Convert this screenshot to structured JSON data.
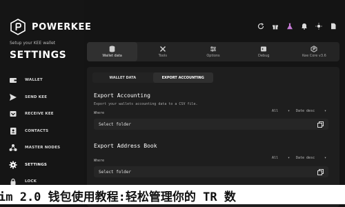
{
  "brand": {
    "name": "POWERKEE"
  },
  "sidebar": {
    "subtitle": "Setup your KEE wallet",
    "title": "SETTINGS",
    "items": [
      {
        "label": "WALLET",
        "icon": "wallet-icon"
      },
      {
        "label": "SEND KEE",
        "icon": "send-icon"
      },
      {
        "label": "RECEIVE KEE",
        "icon": "receive-icon"
      },
      {
        "label": "CONTACTS",
        "icon": "contacts-icon"
      },
      {
        "label": "MASTER NODES",
        "icon": "master-nodes-icon"
      },
      {
        "label": "SETTINGS",
        "icon": "settings-icon",
        "active": true
      },
      {
        "label": "LOCK",
        "icon": "lock-icon"
      }
    ]
  },
  "top_icons": [
    "refresh-icon",
    "gift-icon",
    "flask-icon",
    "bell-icon",
    "sun-icon",
    "document-icon"
  ],
  "tabs": [
    {
      "label": "Wallet data",
      "icon": "database-icon",
      "active": true
    },
    {
      "label": "Tools",
      "icon": "tools-icon"
    },
    {
      "label": "Options",
      "icon": "options-icon"
    },
    {
      "label": "Debug",
      "icon": "debug-icon"
    },
    {
      "label": "Kee Core v3.6",
      "icon": "core-icon"
    }
  ],
  "subtabs": [
    {
      "label": "WALLET DATA"
    },
    {
      "label": "EXPORT ACCOUNTING",
      "active": true
    }
  ],
  "export_accounting": {
    "title": "Export Accounting",
    "description": "Export your wallets accounting data to a CSV file.",
    "where_label": "Where",
    "filter_value": "All",
    "sort_value": "Date desc",
    "folder_placeholder": "Select folder"
  },
  "export_address_book": {
    "title": "Export Address Book",
    "where_label": "Where",
    "filter_value": "All",
    "sort_value": "Date desc",
    "folder_placeholder": "Select folder"
  },
  "caption": "im 2.0 钱包使用教程:轻松管理你的 TR 数"
}
